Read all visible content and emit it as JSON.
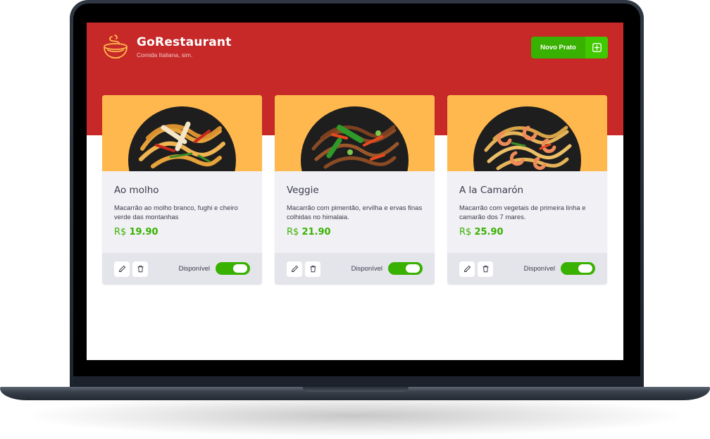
{
  "brand": {
    "title": "GoRestaurant",
    "subtitle": "Comida Italiana, sim.",
    "logo_icon": "noodle-bowl-icon"
  },
  "header": {
    "new_dish_label": "Novo Prato",
    "new_dish_icon": "plus-square-icon"
  },
  "colors": {
    "header_red": "#c72828",
    "accent_green": "#39b100",
    "image_bg": "#ffb84d",
    "card_bg": "#f0f0f5",
    "footer_bg": "#e4e4eb",
    "text": "#3d3d4d"
  },
  "dishes": [
    {
      "name": "Ao molho",
      "description": "Macarrão ao molho branco, fughi e cheiro verde das montanhas",
      "currency": "R$",
      "price": "19.90",
      "availability_label": "Disponível",
      "available": true
    },
    {
      "name": "Veggie",
      "description": "Macarrão com pimentão, ervilha e ervas finas colhidas no himalaia.",
      "currency": "R$",
      "price": "21.90",
      "availability_label": "Disponível",
      "available": true
    },
    {
      "name": "A la Camarón",
      "description": "Macarrão com vegetais de primeira linha e camarão dos 7 mares.",
      "currency": "R$",
      "price": "25.90",
      "availability_label": "Disponível",
      "available": true
    }
  ]
}
